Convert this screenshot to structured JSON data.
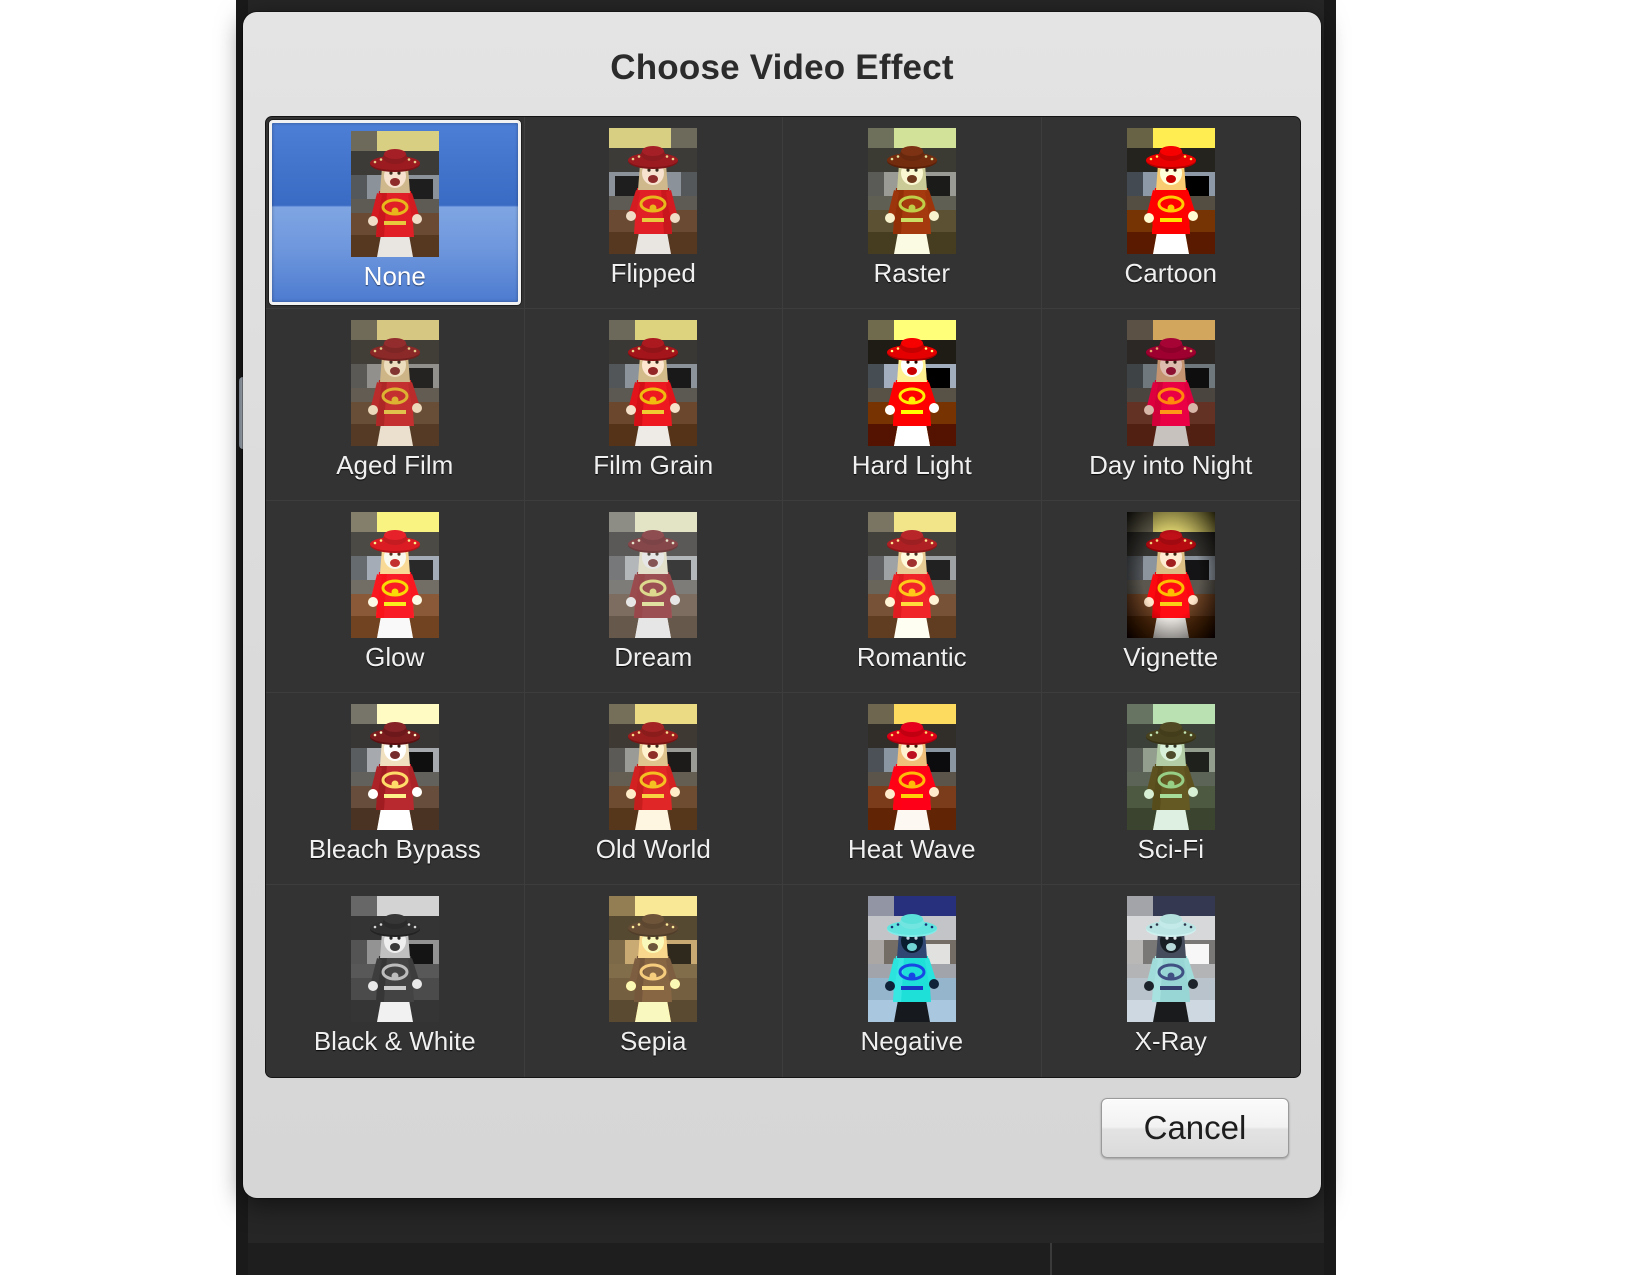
{
  "dialog": {
    "title": "Choose Video Effect",
    "selected_effect": "None",
    "accent_selection_color": "#3a6bc4",
    "panel_background_color": "#2f2f2f",
    "sheet_background_color": "#dcdcdc"
  },
  "footer": {
    "cancel_label": "Cancel"
  },
  "effects": [
    {
      "label": "None",
      "selected": true,
      "style": "none"
    },
    {
      "label": "Flipped",
      "selected": false,
      "style": "flipped"
    },
    {
      "label": "Raster",
      "selected": false,
      "style": "raster"
    },
    {
      "label": "Cartoon",
      "selected": false,
      "style": "cartoon"
    },
    {
      "label": "Aged Film",
      "selected": false,
      "style": "aged-film"
    },
    {
      "label": "Film Grain",
      "selected": false,
      "style": "film-grain"
    },
    {
      "label": "Hard Light",
      "selected": false,
      "style": "hard-light"
    },
    {
      "label": "Day into Night",
      "selected": false,
      "style": "day-into-night"
    },
    {
      "label": "Glow",
      "selected": false,
      "style": "glow"
    },
    {
      "label": "Dream",
      "selected": false,
      "style": "dream"
    },
    {
      "label": "Romantic",
      "selected": false,
      "style": "romantic"
    },
    {
      "label": "Vignette",
      "selected": false,
      "style": "vignette"
    },
    {
      "label": "Bleach Bypass",
      "selected": false,
      "style": "bleach-bypass"
    },
    {
      "label": "Old World",
      "selected": false,
      "style": "old-world"
    },
    {
      "label": "Heat Wave",
      "selected": false,
      "style": "heat-wave"
    },
    {
      "label": "Sci-Fi",
      "selected": false,
      "style": "sci-fi"
    },
    {
      "label": "Black & White",
      "selected": false,
      "style": "black-and-white"
    },
    {
      "label": "Sepia",
      "selected": false,
      "style": "sepia"
    },
    {
      "label": "Negative",
      "selected": false,
      "style": "negative"
    },
    {
      "label": "X-Ray",
      "selected": false,
      "style": "x-ray"
    }
  ],
  "grid": {
    "columns": 4,
    "rows": 5,
    "total_effects": 20
  }
}
